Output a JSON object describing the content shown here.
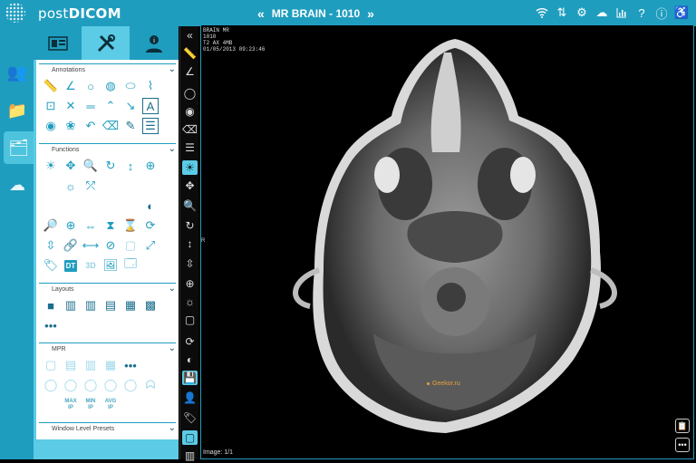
{
  "app": {
    "brand_left": "post",
    "brand_right": "DICOM"
  },
  "study": {
    "title": "MR BRAIN - 1010",
    "prev": "«",
    "next": "»"
  },
  "topbar_icons": [
    "wifi-icon",
    "sort-icon",
    "gear-icon",
    "cloud-icon",
    "chart-icon",
    "help-icon",
    "info-icon",
    "accessibility-icon"
  ],
  "rail": [
    {
      "name": "users-icon"
    },
    {
      "name": "folder-icon"
    },
    {
      "name": "studies-icon",
      "active": true
    },
    {
      "name": "cloud-upload-icon"
    }
  ],
  "panel_tabs": [
    {
      "name": "tab-viewer-list"
    },
    {
      "name": "tab-tools",
      "active": true
    },
    {
      "name": "tab-patient-info"
    }
  ],
  "sections": {
    "annotations": {
      "title": "Annotations"
    },
    "functions": {
      "title": "Functions"
    },
    "layouts": {
      "title": "Layouts"
    },
    "mpr": {
      "title": "MPR",
      "max_ip": "MAX\nIP",
      "min_ip": "MIN\nIP",
      "avg_ip": "AVG\nIP"
    },
    "window_level": {
      "title": "Window Level Presets"
    },
    "dt_label": "DT",
    "td_label": "3D"
  },
  "overlay": {
    "line1": "BRAIN MR",
    "line2": "1010",
    "line3": "T2 AX 4MB",
    "line4": "01/05/2013 09:23:46",
    "orientation": "R",
    "image_counter": "Image: 1/1",
    "watermark": "Geekor.ru"
  },
  "colors": {
    "accent": "#1f9dbf",
    "accent_light": "#5bcbe6",
    "background": "#000000"
  }
}
